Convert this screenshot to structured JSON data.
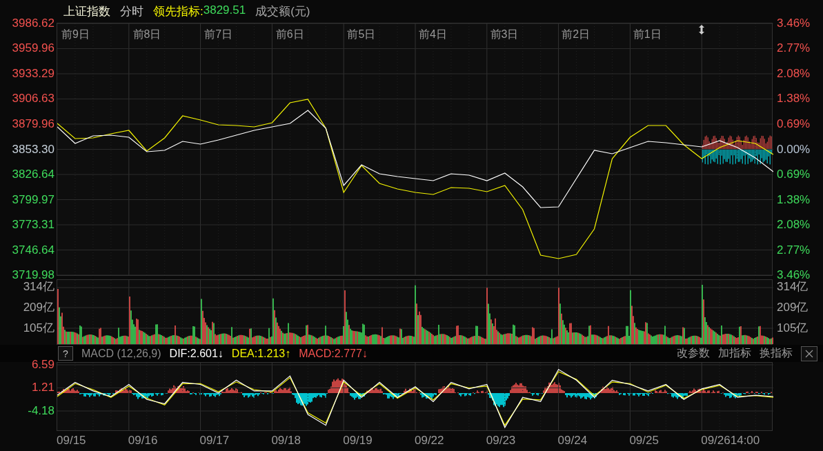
{
  "header": {
    "title": "上证指数",
    "mode": "分时",
    "lead_label": "领先指标:",
    "lead_value": "3829.51",
    "volume_label": "成交额(元)"
  },
  "price_axis_left": [
    {
      "color": "#f4524f"
    },
    {
      "color": "#f4524f"
    },
    {
      "color": "#f4524f"
    },
    {
      "color": "#f4524f"
    },
    {
      "color": "#f4524f"
    },
    {
      "color": "#c8d2dc"
    },
    {
      "color": "#3fdc5c"
    },
    {
      "color": "#3fdc5c"
    },
    {
      "color": "#3fdc5c"
    },
    {
      "color": "#3fdc5c"
    },
    {
      "color": "#3fdc5c"
    }
  ],
  "price_axis_right": [
    {
      "label": "3.46%",
      "color": "#f4524f"
    },
    {
      "label": "2.77%",
      "color": "#f4524f"
    },
    {
      "label": "2.08%",
      "color": "#f4524f"
    },
    {
      "label": "1.38%",
      "color": "#f4524f"
    },
    {
      "label": "0.69%",
      "color": "#f4524f"
    },
    {
      "label": "0.00%",
      "color": "#b8c6d6"
    },
    {
      "label": "0.69%",
      "color": "#3fdc5c"
    },
    {
      "label": "1.38%",
      "color": "#3fdc5c"
    },
    {
      "label": "2.08%",
      "color": "#3fdc5c"
    },
    {
      "label": "2.77%",
      "color": "#3fdc5c"
    },
    {
      "label": "3.46%",
      "color": "#3fdc5c"
    }
  ],
  "day_labels": [
    "前9日",
    "前8日",
    "前7日",
    "前6日",
    "前5日",
    "前4日",
    "前3日",
    "前2日",
    "前1日"
  ],
  "price_chart": {
    "chart_data": {
      "type": "line",
      "ylim": [
        3719.98,
        3986.62
      ],
      "yticks": [
        {
          "value": 3986.62,
          "label": "3986.62"
        },
        {
          "value": 3959.96,
          "label": "3959.96"
        },
        {
          "value": 3933.29,
          "label": "3933.29"
        },
        {
          "value": 3906.63,
          "label": "3906.63"
        },
        {
          "value": 3879.96,
          "label": "3879.96"
        },
        {
          "value": 3853.3,
          "label": "3853.30"
        },
        {
          "value": 3826.64,
          "label": "3826.64"
        },
        {
          "value": 3799.97,
          "label": "3799.97"
        },
        {
          "value": 3773.31,
          "label": "3773.31"
        },
        {
          "value": 3746.64,
          "label": "3746.64"
        },
        {
          "value": 3719.98,
          "label": "3719.98"
        }
      ],
      "grid": true,
      "series": [
        {
          "color": "#ffffff",
          "values": [
            3877.04,
            3859.51,
            3867.55,
            3868.28,
            3866.09,
            3850.75,
            3852.21,
            3861.7,
            3858.78,
            3863.17,
            3868.28,
            3873.39,
            3877.04,
            3880.7,
            3894.58,
            3875.58,
            3814.95,
            3836.87,
            3827.37,
            3824.45,
            3822.26,
            3820.07,
            3827.37,
            3825.91,
            3820.07,
            3828.1,
            3813.49,
            3791.58,
            3792.31,
            3822.26,
            3852.21,
            3848.56,
            3855.13,
            3861.7,
            3860.24,
            3858.05,
            3855.86,
            3862.43,
            3855.13,
            3844.17,
            3829.56
          ]
        },
        {
          "color": "#f5f500",
          "values": [
            3880.7,
            3864.63,
            3865.36,
            3869.74,
            3873.39,
            3851.48,
            3865.36,
            3888.73,
            3884.35,
            3879.24,
            3878.51,
            3877.04,
            3881.43,
            3902.61,
            3906.26,
            3875.58,
            3807.65,
            3836.14,
            3817.14,
            3811.3,
            3807.65,
            3805.46,
            3812.76,
            3812.03,
            3808.38,
            3814.95,
            3789.38,
            3741.17,
            3737.52,
            3741.9,
            3768.93,
            3843.44,
            3866.09,
            3878.51,
            3878.51,
            3858.05,
            3843.44,
            3855.13,
            3862.43,
            3859.51,
            3847.82
          ]
        }
      ]
    }
  },
  "volume_axis_left": [
    "314亿",
    "209亿",
    "105亿"
  ],
  "volume_axis_right": [
    "314亿",
    "209亿",
    "105亿"
  ],
  "macd_header": {
    "help": "?",
    "name": "MACD (12,26,9)",
    "fields": [
      {
        "label": "DIF:2.601↓",
        "kind": "dif"
      },
      {
        "label": "DEA:1.213↑",
        "kind": "dea"
      },
      {
        "label": "MACD:2.777↓",
        "kind": "macd"
      }
    ],
    "buttons": [
      "改参数",
      "加指标",
      "换指标"
    ]
  },
  "macd_chart": {
    "chart_data": {
      "type": "line",
      "ylim": [
        -8.68,
        7.07
      ],
      "yticks": [
        6.59,
        1.21,
        -4.18
      ],
      "grid": true,
      "series": [
        {
          "color": "#ffffff",
          "values": [
            -0.5,
            2.5,
            0.5,
            -0.8,
            2,
            -1.5,
            -2.5,
            2.5,
            2,
            0,
            3,
            0.5,
            0.5,
            4,
            -5,
            -7.5,
            3,
            -1,
            2.5,
            -1,
            1.5,
            -2,
            2.5,
            1,
            2,
            -8,
            -1,
            -2,
            5.5,
            3,
            -1,
            3,
            2,
            0.5,
            2,
            -1.5,
            1,
            2,
            -1,
            -0.5,
            -0.8
          ]
        },
        {
          "color": "#f5f500",
          "values": [
            -0.8,
            2.2,
            0.8,
            -1,
            1.6,
            -1.2,
            -2.8,
            2.2,
            2.2,
            0.3,
            2.6,
            0.8,
            0.2,
            3.6,
            -4.6,
            -7,
            2.6,
            -0.6,
            2.2,
            -1.2,
            1.2,
            -1.6,
            2.2,
            1.2,
            1.6,
            -7.5,
            -1.4,
            -1.6,
            5,
            3.2,
            -0.6,
            2.6,
            2.2,
            0.2,
            1.8,
            -1.2,
            0.8,
            1.8,
            -0.8,
            -0.6,
            -1
          ]
        }
      ]
    }
  },
  "macd_axis": [
    {
      "label": "6.59",
      "color": "#f4524f"
    },
    {
      "label": "1.21",
      "color": "#f4524f"
    },
    {
      "label": "-4.18",
      "color": "#3fdc5c"
    }
  ],
  "date_axis": [
    "09/15",
    "09/16",
    "09/17",
    "09/18",
    "09/19",
    "09/22",
    "09/23",
    "09/24",
    "09/25",
    "09/26"
  ],
  "time_label": "14:00"
}
